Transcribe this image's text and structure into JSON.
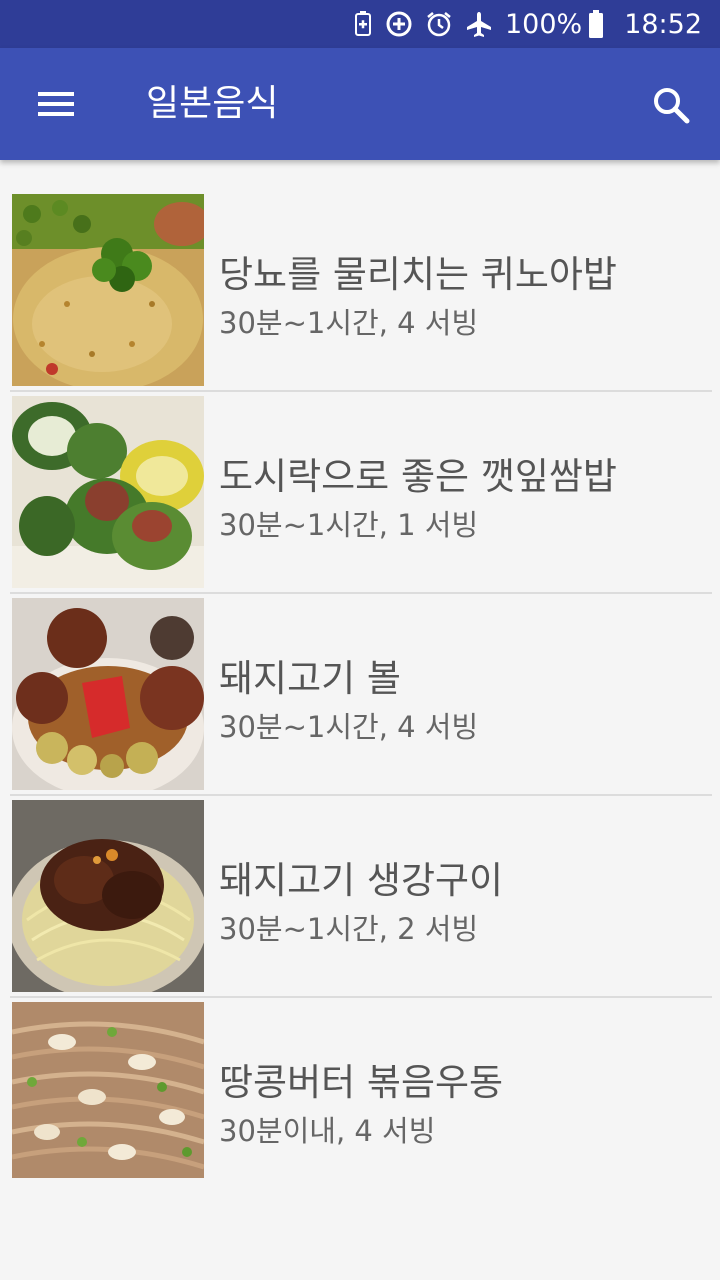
{
  "status_bar": {
    "battery_percent": "100%",
    "time": "18:52",
    "icons": [
      "battery-saver-icon",
      "data-saver-icon",
      "alarm-icon",
      "airplane-mode-icon",
      "battery-icon"
    ]
  },
  "app_bar": {
    "title": "일본음식",
    "menu_icon": "menu-icon",
    "search_icon": "search-icon"
  },
  "recipes": [
    {
      "title": "당뇨를 물리치는 퀴노아밥",
      "meta": "30분~1시간, 4 서빙"
    },
    {
      "title": "도시락으로 좋은 깻잎쌈밥",
      "meta": "30분~1시간, 1 서빙"
    },
    {
      "title": "돼지고기 볼",
      "meta": "30분~1시간, 4 서빙"
    },
    {
      "title": "돼지고기 생강구이",
      "meta": "30분~1시간, 2 서빙"
    },
    {
      "title": "땅콩버터 볶음우동",
      "meta": "30분이내, 4 서빙"
    }
  ],
  "colors": {
    "status_bar": "#2f3d97",
    "app_bar": "#3d51b5",
    "background": "#f5f5f5",
    "title_text": "#555555",
    "meta_text": "#666666"
  }
}
